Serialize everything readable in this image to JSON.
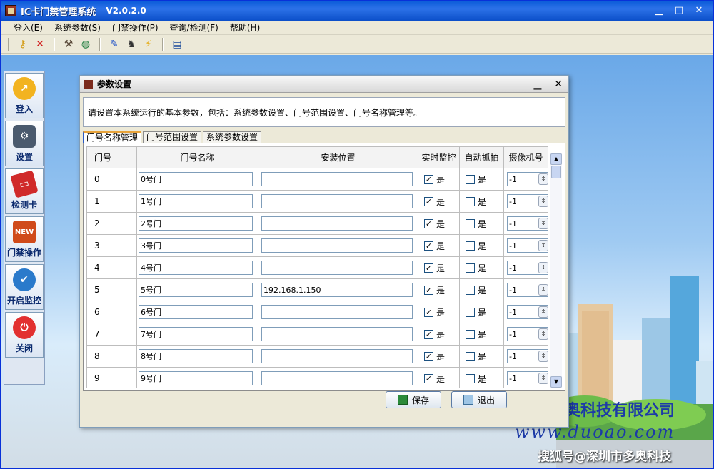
{
  "window": {
    "title": "IC卡门禁管理系统",
    "version": "V2.0.2.0",
    "minimize": "▁",
    "maximize": "□",
    "close": "✕"
  },
  "menu": [
    {
      "label": "登入(E)"
    },
    {
      "label": "系统参数(S)"
    },
    {
      "label": "门禁操作(P)"
    },
    {
      "label": "查询/检测(F)"
    },
    {
      "label": "帮助(H)"
    }
  ],
  "toolbar": {
    "icons": [
      "key-icon",
      "delete-icon",
      "tool-icon",
      "globe-icon",
      "pin-icon",
      "chess-icon",
      "lightning-icon",
      "book-icon"
    ]
  },
  "sidebar": [
    {
      "label": "登入",
      "icon": "login-icon",
      "color": "#f2b320"
    },
    {
      "label": "设置",
      "icon": "settings-icon",
      "color": "#4a5a6e"
    },
    {
      "label": "检测卡",
      "icon": "card-check-icon",
      "color": "#d02a2a"
    },
    {
      "label": "门禁操作",
      "icon": "door-control-icon",
      "color": "#d04a1a"
    },
    {
      "label": "开启监控",
      "icon": "monitor-icon",
      "color": "#2a7acb"
    },
    {
      "label": "关闭",
      "icon": "power-icon",
      "color": "#e23030"
    }
  ],
  "dialog": {
    "title": "参数设置",
    "description": "请设置本系统运行的基本参数，包括：系统参数设置、门号范围设置、门号名称管理等。",
    "tabs": [
      "门号名称管理",
      "门号范围设置",
      "系统参数设置"
    ],
    "columns": [
      "门号",
      "门号名称",
      "安装位置",
      "实时监控",
      "自动抓拍",
      "摄像机号"
    ],
    "rows": [
      {
        "no": "0",
        "name": "0号门",
        "location": "",
        "monitor": true,
        "capture": false,
        "camera": "-1"
      },
      {
        "no": "1",
        "name": "1号门",
        "location": "",
        "monitor": true,
        "capture": false,
        "camera": "-1"
      },
      {
        "no": "2",
        "name": "2号门",
        "location": "",
        "monitor": true,
        "capture": false,
        "camera": "-1"
      },
      {
        "no": "3",
        "name": "3号门",
        "location": "",
        "monitor": true,
        "capture": false,
        "camera": "-1"
      },
      {
        "no": "4",
        "name": "4号门",
        "location": "",
        "monitor": true,
        "capture": false,
        "camera": "-1"
      },
      {
        "no": "5",
        "name": "5号门",
        "location": "192.168.1.150",
        "monitor": true,
        "capture": false,
        "camera": "-1"
      },
      {
        "no": "6",
        "name": "6号门",
        "location": "",
        "monitor": true,
        "capture": false,
        "camera": "-1"
      },
      {
        "no": "7",
        "name": "7号门",
        "location": "",
        "monitor": true,
        "capture": false,
        "camera": "-1"
      },
      {
        "no": "8",
        "name": "8号门",
        "location": "",
        "monitor": true,
        "capture": false,
        "camera": "-1"
      },
      {
        "no": "9",
        "name": "9号门",
        "location": "",
        "monitor": true,
        "capture": false,
        "camera": "-1"
      }
    ],
    "yes_label": "是",
    "save_label": "保存",
    "exit_label": "退出"
  },
  "branding": {
    "company": "奥科技有限公司",
    "url": "www.duoao.com",
    "watermark": "搜狐号@深圳市多奥科技"
  }
}
